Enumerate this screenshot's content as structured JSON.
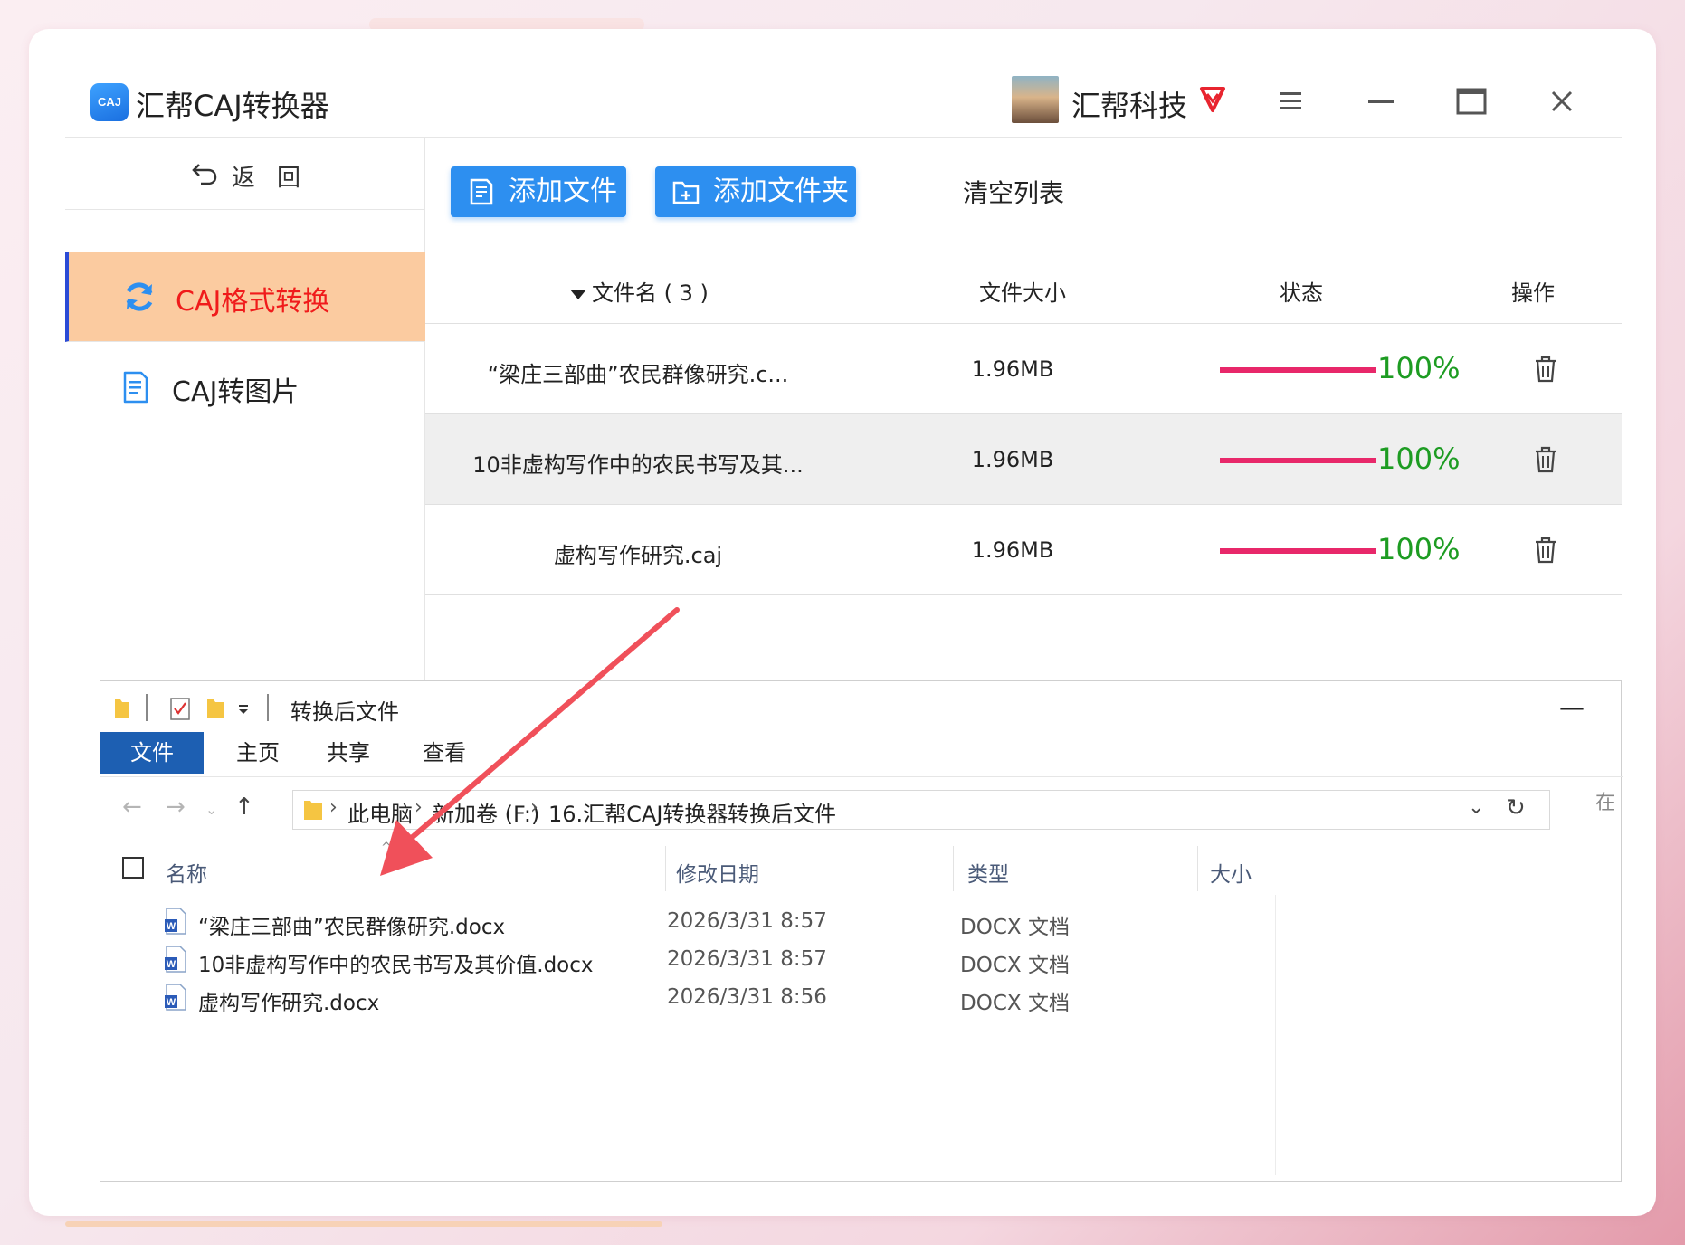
{
  "app": {
    "title": "汇帮CAJ转换器",
    "logo_text": "CAJ",
    "user_name": "汇帮科技"
  },
  "sidebar": {
    "back_label": "返回",
    "items": [
      {
        "label": "CAJ格式转换",
        "icon": "refresh-icon",
        "active": true
      },
      {
        "label": "CAJ转图片",
        "icon": "document-icon",
        "active": false
      }
    ]
  },
  "toolbar": {
    "add_file_label": "添加文件",
    "add_folder_label": "添加文件夹",
    "clear_list_label": "清空列表"
  },
  "table": {
    "headers": {
      "name": "文件名 ( 3 )",
      "size": "文件大小",
      "status": "状态",
      "operation": "操作"
    },
    "rows": [
      {
        "name": "“梁庄三部曲”农民群像研究.c...",
        "size": "1.96MB",
        "progress": "100%",
        "progress_value": 1.0
      },
      {
        "name": "10非虚构写作中的农民书写及其...",
        "size": "1.96MB",
        "progress": "100%",
        "progress_value": 1.0
      },
      {
        "name": "虚构写作研究.caj",
        "size": "1.96MB",
        "progress": "100%",
        "progress_value": 1.0
      }
    ]
  },
  "explorer": {
    "title": "转换后文件",
    "tabs": [
      "文件",
      "主页",
      "共享",
      "查看"
    ],
    "breadcrumb": [
      "此电脑",
      "新加卷 (F:)",
      "16.汇帮CAJ转换器",
      "转换后文件"
    ],
    "search_stub": "在",
    "columns": {
      "name": "名称",
      "date": "修改日期",
      "type": "类型",
      "size": "大小"
    },
    "files": [
      {
        "name": "“梁庄三部曲”农民群像研究.docx",
        "date": "2026/3/31 8:57",
        "type": "DOCX 文档"
      },
      {
        "name": "10非虚构写作中的农民书写及其价值.docx",
        "date": "2026/3/31 8:57",
        "type": "DOCX 文档"
      },
      {
        "name": "虚构写作研究.docx",
        "date": "2026/3/31 8:56",
        "type": "DOCX 文档"
      }
    ]
  },
  "colors": {
    "accent_blue": "#2d8ff0",
    "active_bg": "#fbcba0",
    "active_text": "#f01b1b",
    "progress_bar": "#e8286a",
    "progress_text": "#1d9c22",
    "annotation_arrow": "#f0505a"
  }
}
